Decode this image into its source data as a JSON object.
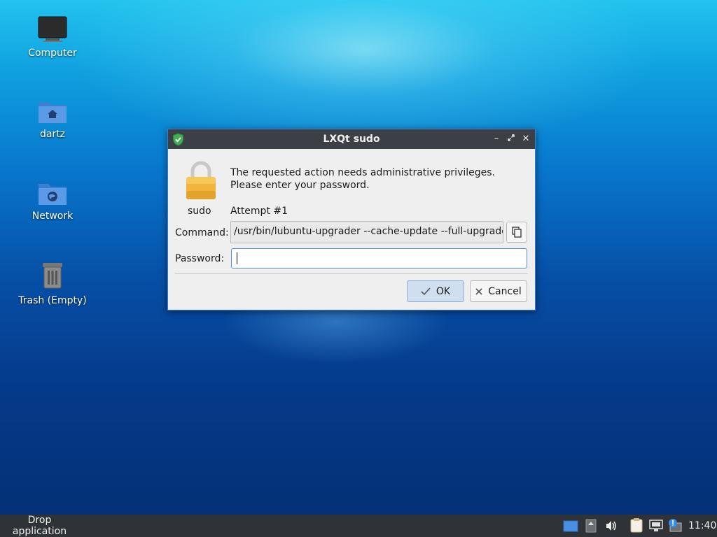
{
  "desktop": {
    "icons": [
      {
        "label": "Computer",
        "icon": "computer-icon"
      },
      {
        "label": "dartz",
        "icon": "home-folder-icon"
      },
      {
        "label": "Network",
        "icon": "network-folder-icon"
      },
      {
        "label": "Trash (Empty)",
        "icon": "trash-icon"
      }
    ]
  },
  "dialog": {
    "title": "LXQt sudo",
    "icon_label": "sudo",
    "message_line1": "The requested action needs administrative privileges.",
    "message_line2": "Please enter your password.",
    "attempt": "Attempt #1",
    "command_label": "Command:",
    "command_value": "/usr/bin/lubuntu-upgrader --cache-update --full-upgrade",
    "password_label": "Password:",
    "password_value": "",
    "ok_label": "OK",
    "cancel_label": "Cancel",
    "window_controls": [
      "minimize-icon",
      "maximize-icon",
      "close-icon"
    ]
  },
  "taskbar": {
    "drop_text": "Drop application icons here",
    "tray": [
      "desktop-switcher-icon",
      "updates-icon",
      "volume-icon",
      "clipboard-icon",
      "network-icon",
      "notification-icon"
    ],
    "clock": "11:40"
  },
  "colors": {
    "titlebar": "#3c3f45",
    "accent": "#3a7fd0",
    "dialog_bg": "#efefef",
    "taskbar": "#2f3338"
  }
}
